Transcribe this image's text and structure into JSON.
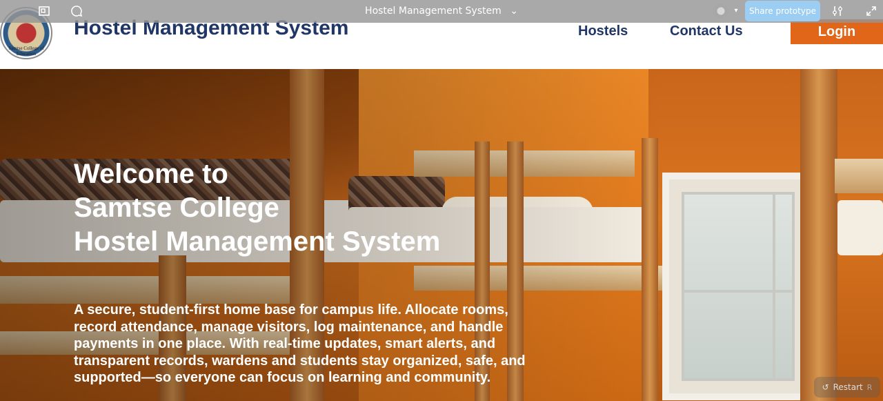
{
  "prototype_bar": {
    "title": "Hostel Management System",
    "share_label": "Share prototype",
    "icons": [
      "frame-icon",
      "comment-icon",
      "chevron-down-icon",
      "settings-sliders-icon",
      "expand-icon"
    ]
  },
  "header": {
    "logo_caption": "Samtse College of Education",
    "brand": "Hostel Management System",
    "nav": [
      "Hostels",
      "Contact Us"
    ],
    "login_label": "Login"
  },
  "hero": {
    "title_lines": [
      "Welcome to",
      "Samtse College",
      "Hostel Management System"
    ],
    "description": "A secure, student-first home base for campus life. Allocate rooms, record attendance, manage visitors, log maintenance, and handle payments in one place. With real-time updates, smart alerts, and transparent records, wardens and students stay organized, safe, and supported—so everyone can focus on learning and community."
  },
  "restart": {
    "label": "Restart",
    "key": "R"
  },
  "colors": {
    "brand_navy": "#1f3666",
    "accent_orange": "#e1661a",
    "share_blue": "#9ccdf2"
  }
}
